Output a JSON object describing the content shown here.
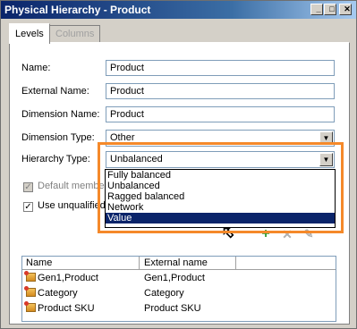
{
  "window": {
    "title": "Physical Hierarchy - Product",
    "minimize_glyph": "_",
    "maximize_glyph": "□",
    "close_glyph": "✕"
  },
  "tabs": [
    {
      "label": "Levels",
      "active": true
    },
    {
      "label": "Columns",
      "active": false
    }
  ],
  "form": {
    "name_label": "Name:",
    "name_value": "Product",
    "external_name_label": "External Name:",
    "external_name_value": "Product",
    "dimension_name_label": "Dimension Name:",
    "dimension_name_value": "Product",
    "dimension_type_label": "Dimension Type:",
    "dimension_type_value": "Other",
    "hierarchy_type_label": "Hierarchy Type:",
    "hierarchy_type_value": "Unbalanced",
    "hierarchy_type_options": [
      "Fully balanced",
      "Unbalanced",
      "Ragged balanced",
      "Network",
      "Value"
    ],
    "hierarchy_type_highlighted": "Value",
    "default_member_label": "Default member",
    "use_unqualified_label": "Use unqualified"
  },
  "list": {
    "columns": [
      "Name",
      "External name"
    ],
    "rows": [
      {
        "name": "Gen1,Product",
        "external": "Gen1,Product"
      },
      {
        "name": "Category",
        "external": "Category"
      },
      {
        "name": "Product SKU",
        "external": "Product SKU"
      }
    ]
  },
  "colors": {
    "highlight_box": "#f5892a",
    "selected_option": "#0a246a"
  }
}
